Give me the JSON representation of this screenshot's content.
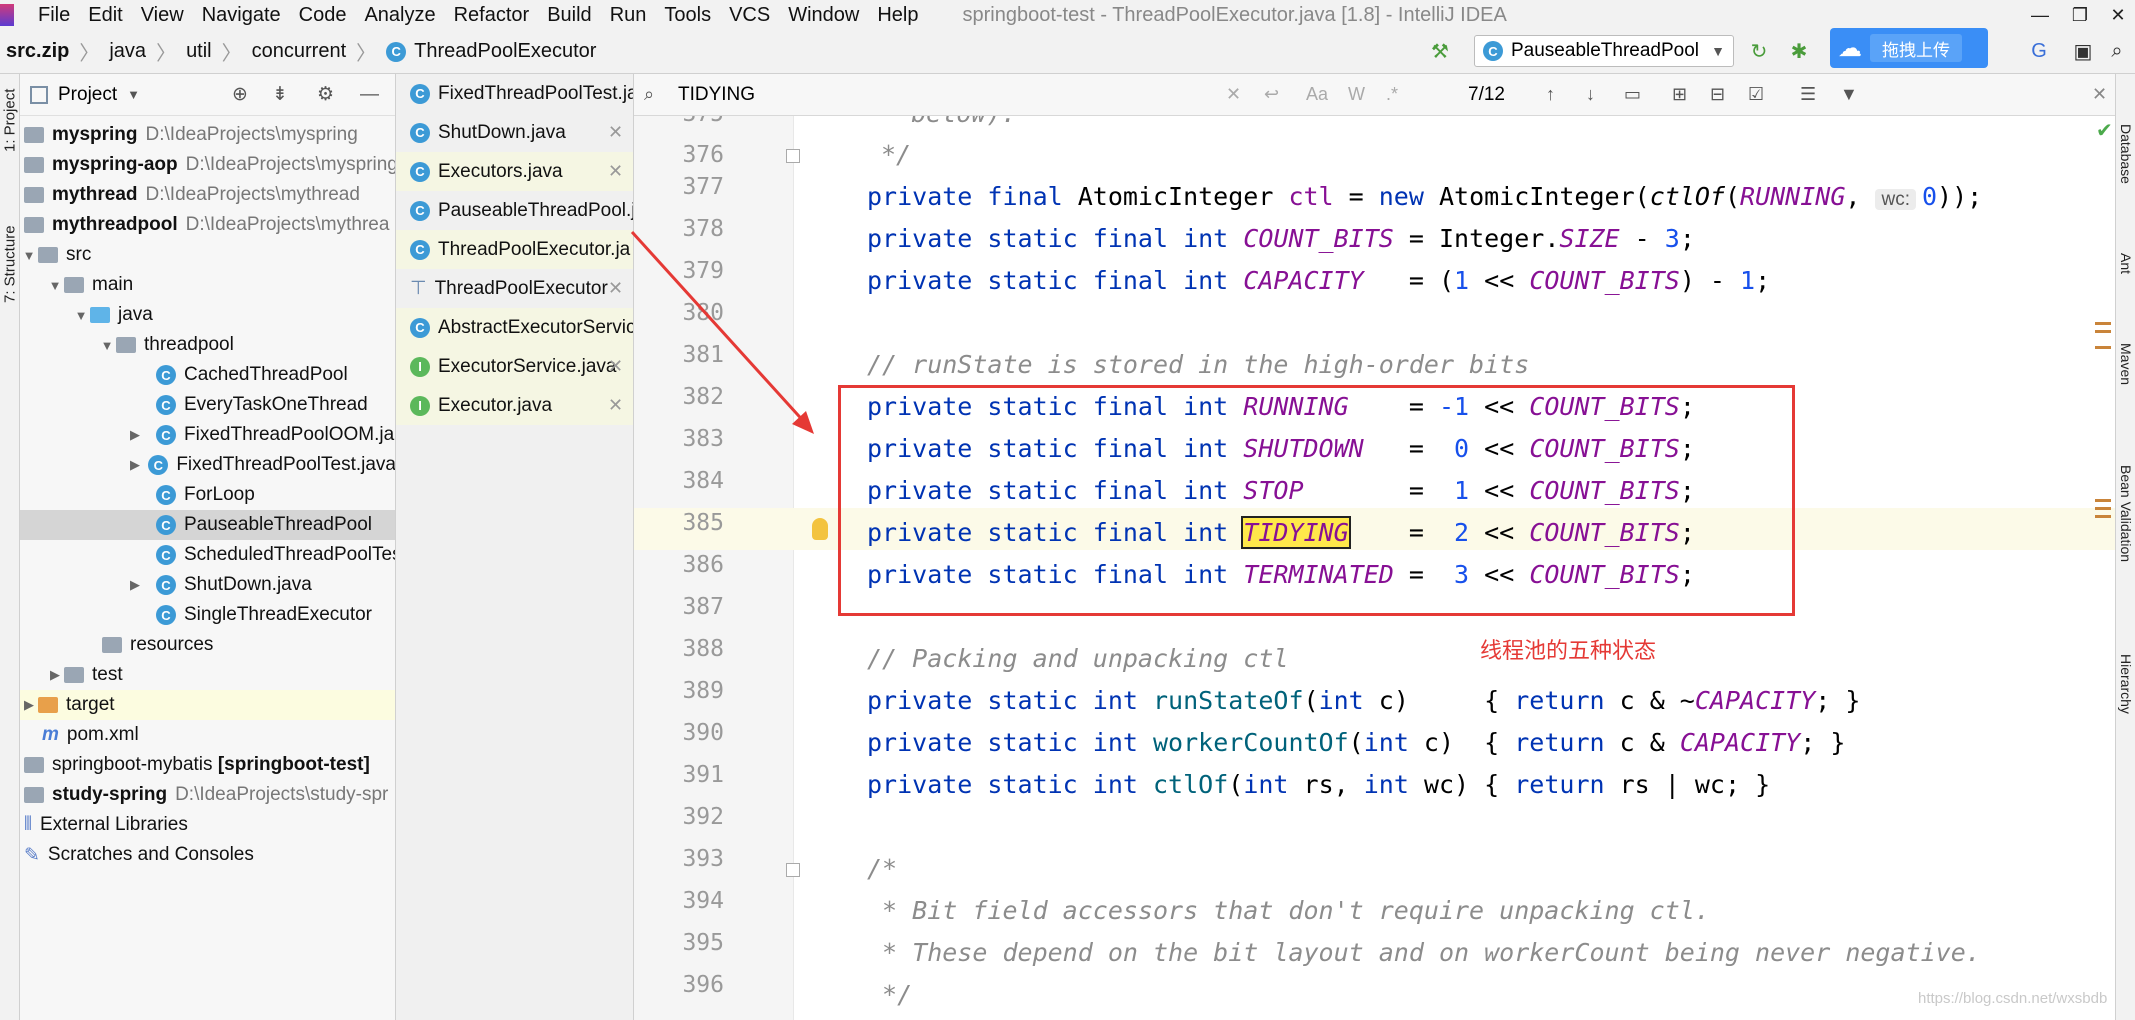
{
  "menubar": {
    "items": [
      "File",
      "Edit",
      "View",
      "Navigate",
      "Code",
      "Analyze",
      "Refactor",
      "Build",
      "Run",
      "Tools",
      "VCS",
      "Window",
      "Help"
    ],
    "window_title": "springboot-test - ThreadPoolExecutor.java [1.8] - IntelliJ IDEA"
  },
  "breadcrumb": [
    "src.zip",
    "java",
    "util",
    "concurrent",
    "ThreadPoolExecutor"
  ],
  "toolbar": {
    "run_config": "PauseableThreadPool",
    "upload_label": "拖拽上传"
  },
  "left_tool_tabs": [
    "1: Project",
    "7: Structure"
  ],
  "right_tool_tabs": [
    "Database",
    "Ant",
    "Maven",
    "Bean Validation",
    "Hierarchy"
  ],
  "project_panel": {
    "title": "Project",
    "tree": [
      {
        "label": "myspring",
        "path": "D:\\IdeaProjects\\myspring",
        "bold": true
      },
      {
        "label": "myspring-aop",
        "path": "D:\\IdeaProjects\\myspring",
        "bold": true
      },
      {
        "label": "mythread",
        "path": "D:\\IdeaProjects\\mythread",
        "bold": true
      },
      {
        "label": "mythreadpool",
        "path": "D:\\IdeaProjects\\mythrea",
        "bold": true
      },
      {
        "label": "src"
      },
      {
        "label": "main"
      },
      {
        "label": "java"
      },
      {
        "label": "threadpool"
      },
      {
        "label": "CachedThreadPool"
      },
      {
        "label": "EveryTaskOneThread"
      },
      {
        "label": "FixedThreadPoolOOM.ja"
      },
      {
        "label": "FixedThreadPoolTest.java"
      },
      {
        "label": "ForLoop"
      },
      {
        "label": "PauseableThreadPool"
      },
      {
        "label": "ScheduledThreadPoolTes"
      },
      {
        "label": "ShutDown.java"
      },
      {
        "label": "SingleThreadExecutor"
      },
      {
        "label": "resources"
      },
      {
        "label": "test"
      },
      {
        "label": "target"
      },
      {
        "label": "pom.xml"
      },
      {
        "label": "springboot-mybatis",
        "extra": "[springboot-test]"
      },
      {
        "label": "study-spring",
        "path": "D:\\IdeaProjects\\study-spr",
        "bold": true
      },
      {
        "label": "External Libraries"
      },
      {
        "label": "Scratches and Consoles"
      }
    ]
  },
  "open_files": [
    "FixedThreadPoolTest.ja",
    "ShutDown.java",
    "Executors.java",
    "PauseableThreadPool.j",
    "ThreadPoolExecutor.ja",
    "ThreadPoolExecutor",
    "AbstractExecutorServic",
    "ExecutorService.java",
    "Executor.java"
  ],
  "search": {
    "query": "TIDYING",
    "count": "7/12",
    "opt_case": "Aa",
    "opt_word": "W",
    "opt_regex": ".*"
  },
  "editor": {
    "line_numbers": [
      "375",
      "376",
      "377",
      "378",
      "379",
      "380",
      "381",
      "382",
      "383",
      "384",
      "385",
      "386",
      "387",
      "388",
      "389",
      "390",
      "391",
      "392",
      "393",
      "394",
      "395",
      "396"
    ],
    "lines": {
      "l375": "* below).",
      "l376": "*/",
      "l377_a": "private final ",
      "l377_b": "AtomicInteger ",
      "l377_c": "ctl",
      "l377_d": " = ",
      "l377_e": "new ",
      "l377_f": "AtomicInteger(",
      "l377_g": "ctlOf",
      "l377_h": "(",
      "l377_i": "RUNNING",
      "l377_j": ", ",
      "l377_hint": "wc:",
      "l377_k": "0",
      "l377_l": "));",
      "l378_a": "private static final int ",
      "l378_b": "COUNT_BITS",
      "l378_c": " = Integer.",
      "l378_d": "SIZE",
      "l378_e": " - ",
      "l378_f": "3",
      "l378_g": ";",
      "l379_a": "private static final int ",
      "l379_b": "CAPACITY",
      "l379_c": "   = (",
      "l379_d": "1",
      "l379_e": " << ",
      "l379_f": "COUNT_BITS",
      "l379_g": ") - ",
      "l379_h": "1",
      "l379_i": ";",
      "l381": "// runState is stored in the high-order bits",
      "states": [
        {
          "decl": "private static final int ",
          "name": "RUNNING",
          "pad": "    = ",
          "val": "-1"
        },
        {
          "decl": "private static final int ",
          "name": "SHUTDOWN",
          "pad": "   =  ",
          "val": "0"
        },
        {
          "decl": "private static final int ",
          "name": "STOP",
          "pad": "       =  ",
          "val": "1"
        },
        {
          "decl": "private static final int ",
          "name": "TIDYING",
          "pad": "    =  ",
          "val": "2"
        },
        {
          "decl": "private static final int ",
          "name": "TERMINATED",
          "pad": " =  ",
          "val": "3"
        }
      ],
      "shift": " << ",
      "count_bits": "COUNT_BITS",
      "semicolon": ";",
      "l388": "// Packing and unpacking ctl",
      "l389_a": "private static int ",
      "l389_b": "runStateOf",
      "l389_c": "(",
      "l389_d": "int",
      "l389_e": " c)     { ",
      "l389_f": "return",
      "l389_g": " c & ~",
      "l389_h": "CAPACITY",
      "l389_i": "; }",
      "l390_a": "private static int ",
      "l390_b": "workerCountOf",
      "l390_c": "(",
      "l390_d": "int",
      "l390_e": " c)  { ",
      "l390_f": "return",
      "l390_g": " c & ",
      "l390_h": "CAPACITY",
      "l390_i": "; }",
      "l391_a": "private static int ",
      "l391_b": "ctlOf",
      "l391_c": "(",
      "l391_d": "int",
      "l391_e": " rs, ",
      "l391_f": "int",
      "l391_g": " wc) { ",
      "l391_h": "return",
      "l391_i": " rs | wc; }",
      "l393": "/*",
      "l394": " * Bit field accessors that don't require unpacking ctl.",
      "l395": " * These depend on the bit layout and on workerCount being never negative.",
      "l396": " */"
    }
  },
  "annotation": "线程池的五种状态",
  "watermark": "https://blog.csdn.net/wxsbdb",
  "colors": {
    "keyword": "#0033b3",
    "constant": "#871094",
    "number": "#1750eb",
    "comment": "#8c8c8c",
    "annotation": "#e53935"
  }
}
